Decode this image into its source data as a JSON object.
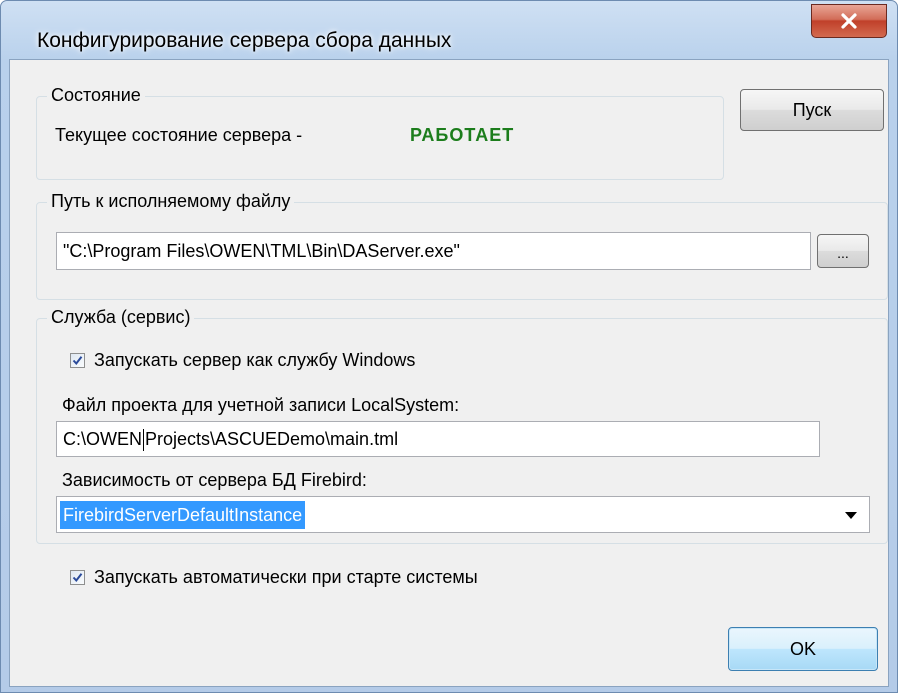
{
  "window": {
    "title": "Конфигурирование сервера сбора данных",
    "close_glyph": "X"
  },
  "state_group": {
    "label": "Состояние",
    "current_state_label": "Текущее состояние сервера -",
    "current_state_value": "РАБОТАЕТ",
    "status_color": "#1c7d1c",
    "start_button": "Пуск"
  },
  "path_group": {
    "label": "Путь к исполняемому файлу",
    "path_value": "\"C:\\Program Files\\OWEN\\TML\\Bin\\DAServer.exe\"",
    "browse_button": "..."
  },
  "service_group": {
    "label": "Служба (сервис)",
    "run_as_service_checkbox": {
      "label": "Запускать сервер как службу Windows",
      "checked": true
    },
    "project_file_label": "Файл проекта для учетной записи LocalSystem:",
    "project_file_value_before_caret": "C:\\OWEN",
    "project_file_value_after_caret": "Projects\\ASCUEDemo\\main.tml",
    "firebird_dependency_label": "Зависимость от сервера БД Firebird:",
    "firebird_dependency_value": "FirebirdServerDefaultInstance"
  },
  "autostart_checkbox": {
    "label": "Запускать автоматически при старте системы",
    "checked": true
  },
  "ok_button": "OK"
}
